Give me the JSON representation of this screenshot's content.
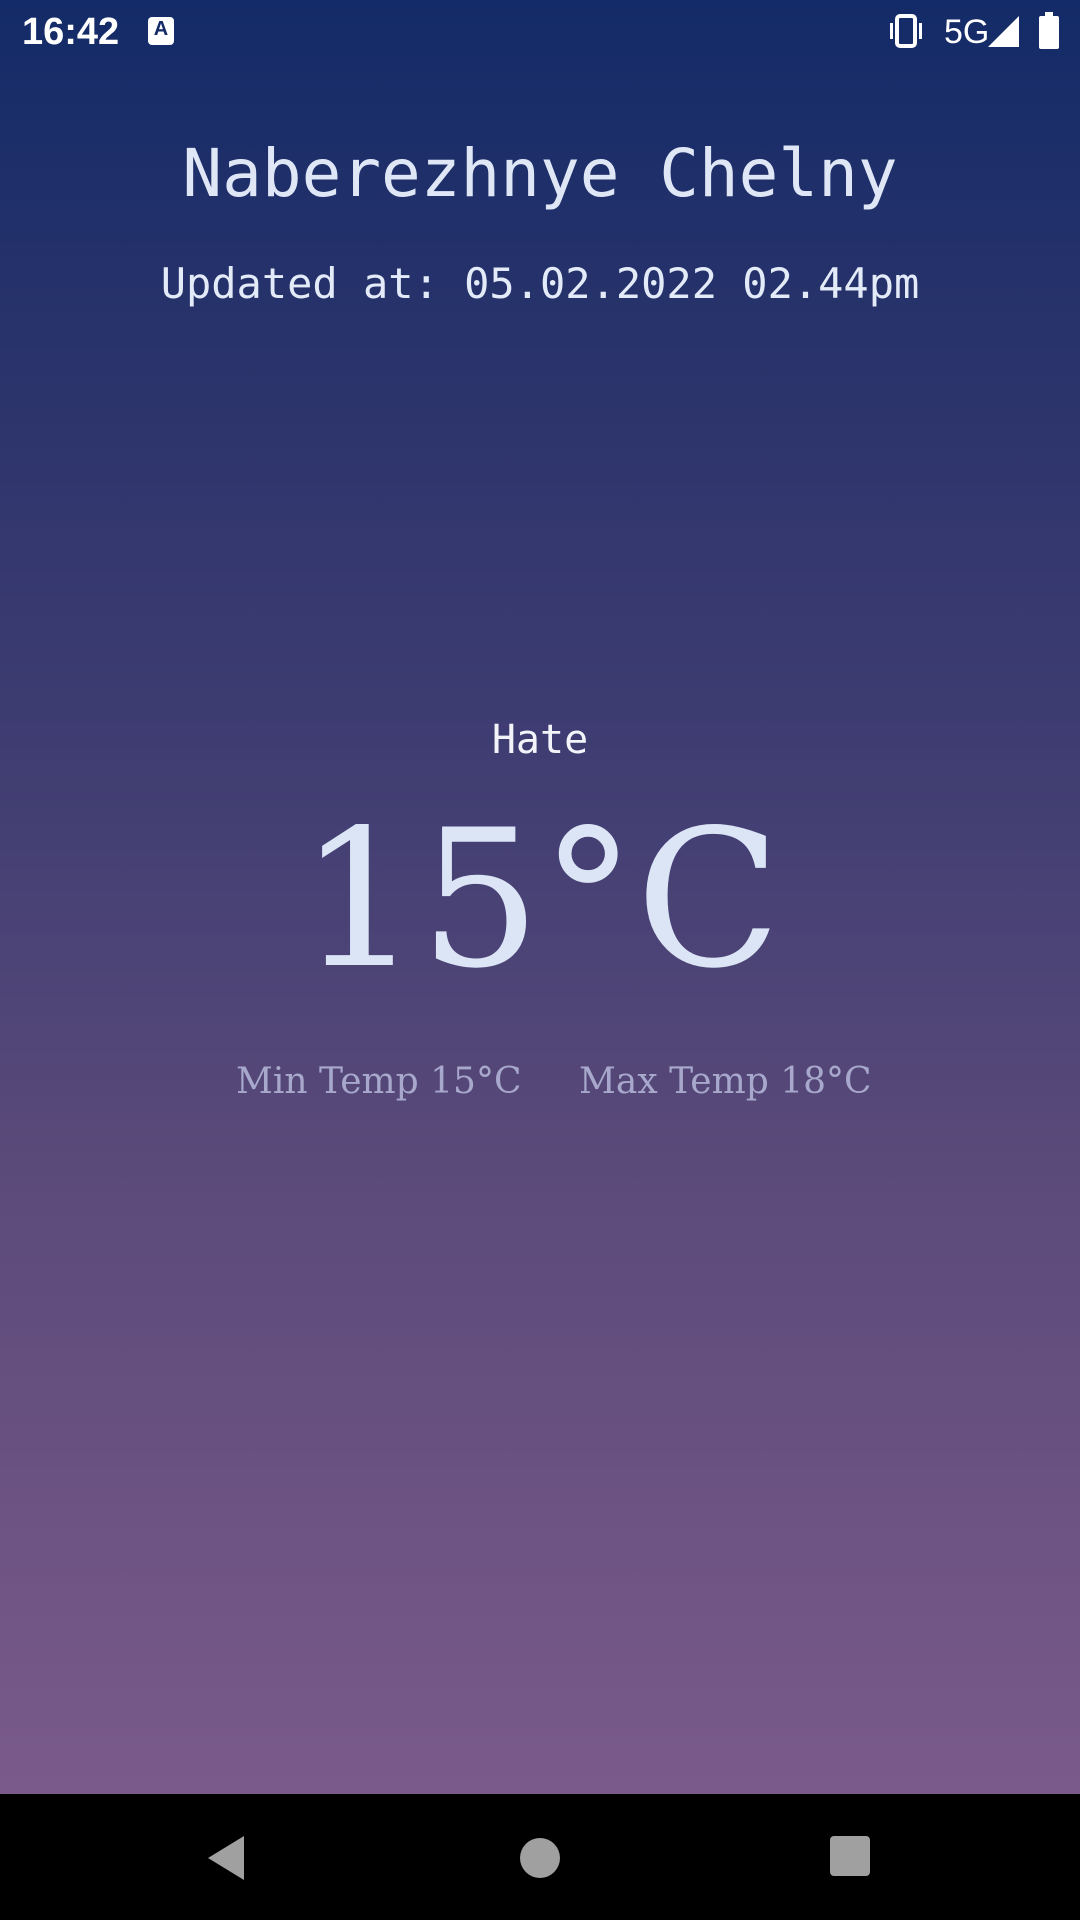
{
  "status_bar": {
    "time": "16:42",
    "app_icon_letter": "A",
    "network": "5G",
    "icons": [
      "text-a-icon",
      "vibrate-icon",
      "signal-icon",
      "battery-icon"
    ]
  },
  "weather": {
    "city": "Naberezhnye Chelny",
    "updated": "Updated at: 05.02.2022 02.44pm",
    "description": "Hate",
    "temperature": "15°C",
    "min_temp": "Min Temp 15°C",
    "max_temp": "Max Temp 18°C"
  },
  "nav_bar": {
    "icons": [
      "back-icon",
      "home-icon",
      "recents-icon"
    ]
  },
  "colors": {
    "gradient_top": "#132b68",
    "gradient_bottom": "#7a5a8a",
    "primary_text": "#dfe7f7",
    "secondary_text": "#a7a8cc"
  }
}
